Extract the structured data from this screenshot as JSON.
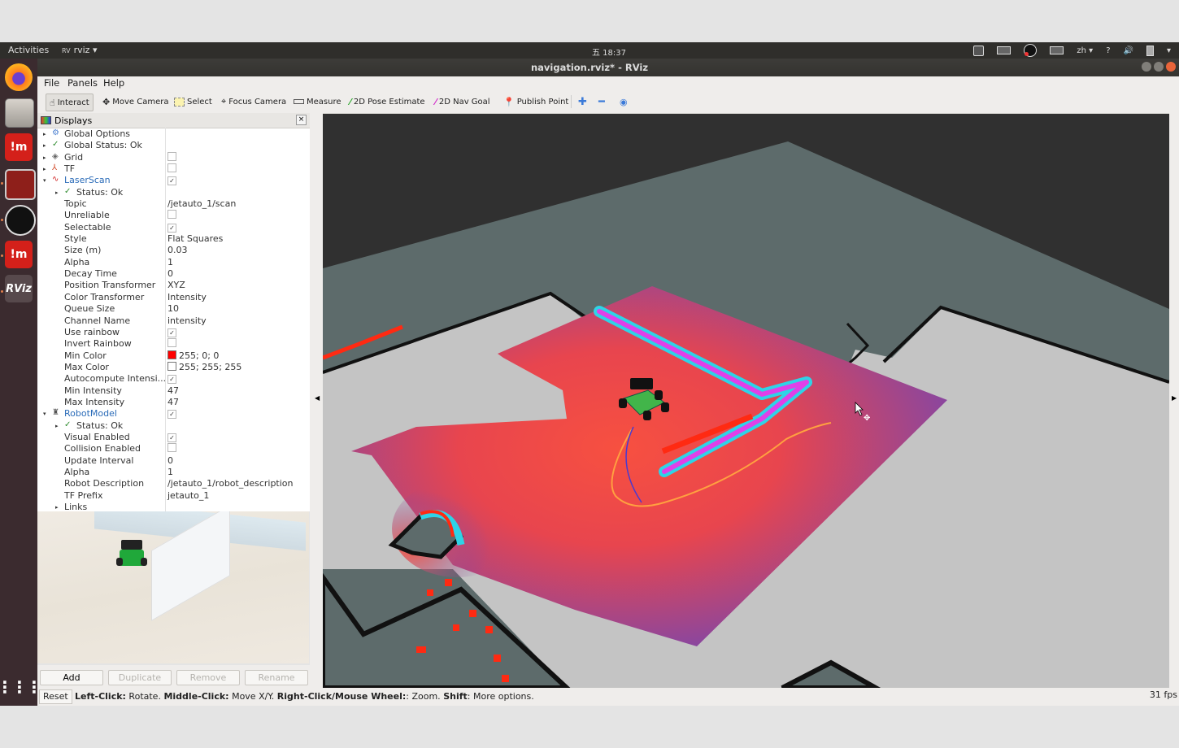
{
  "topbar": {
    "activities": "Activities",
    "app_menu": "rviz ▾",
    "clock": "五 18:37",
    "tray": [
      "im-icon",
      "keyboard-icon",
      "obs-icon",
      "keyboard-icon-2",
      "zh ▾",
      "?",
      "volume-icon",
      "battery-icon",
      "menu-arrow"
    ],
    "lang": "zh ▾",
    "help": "?"
  },
  "window": {
    "title": "navigation.rviz* - RViz"
  },
  "dock": {
    "items": [
      "firefox",
      "files",
      "im-app",
      "video-app",
      "obs",
      "im-app-2",
      "rviz"
    ],
    "rviz_label": "RViz",
    "im_label": "!m",
    "grid_label": "⋮⋮⋮"
  },
  "menu": {
    "file": "File",
    "panels": "Panels",
    "help": "Help"
  },
  "toolbar": {
    "interact": "Interact",
    "move_camera": "Move Camera",
    "select": "Select",
    "focus_camera": "Focus Camera",
    "measure": "Measure",
    "pose_estimate": "2D Pose Estimate",
    "nav_goal": "2D Nav Goal",
    "publish_point": "Publish Point"
  },
  "displays": {
    "title": "Displays",
    "rows": [
      {
        "label": "Global Options",
        "value": ""
      },
      {
        "label": "Global Status: Ok",
        "value": ""
      },
      {
        "label": "Grid",
        "value": ""
      },
      {
        "label": "TF",
        "value": ""
      },
      {
        "label": "LaserScan",
        "value": ""
      },
      {
        "label": "Status: Ok",
        "value": ""
      },
      {
        "label": "Topic",
        "value": "/jetauto_1/scan"
      },
      {
        "label": "Unreliable",
        "value": ""
      },
      {
        "label": "Selectable",
        "value": ""
      },
      {
        "label": "Style",
        "value": "Flat Squares"
      },
      {
        "label": "Size (m)",
        "value": "0.03"
      },
      {
        "label": "Alpha",
        "value": "1"
      },
      {
        "label": "Decay Time",
        "value": "0"
      },
      {
        "label": "Position Transformer",
        "value": "XYZ"
      },
      {
        "label": "Color Transformer",
        "value": "Intensity"
      },
      {
        "label": "Queue Size",
        "value": "10"
      },
      {
        "label": "Channel Name",
        "value": "intensity"
      },
      {
        "label": "Use rainbow",
        "value": ""
      },
      {
        "label": "Invert Rainbow",
        "value": ""
      },
      {
        "label": "Min Color",
        "value": "255; 0; 0"
      },
      {
        "label": "Max Color",
        "value": "255; 255; 255"
      },
      {
        "label": "Autocompute Intensi...",
        "value": ""
      },
      {
        "label": "Min Intensity",
        "value": "47"
      },
      {
        "label": "Max Intensity",
        "value": "47"
      },
      {
        "label": "RobotModel",
        "value": ""
      },
      {
        "label": "Status: Ok",
        "value": ""
      },
      {
        "label": "Visual Enabled",
        "value": ""
      },
      {
        "label": "Collision Enabled",
        "value": ""
      },
      {
        "label": "Update Interval",
        "value": "0"
      },
      {
        "label": "Alpha",
        "value": "1"
      },
      {
        "label": "Robot Description",
        "value": "/jetauto_1/robot_description"
      },
      {
        "label": "TF Prefix",
        "value": "jetauto_1"
      },
      {
        "label": "Links",
        "value": ""
      }
    ],
    "checks": {
      "grid": false,
      "tf": false,
      "laserscan": true,
      "unreliable": false,
      "selectable": true,
      "use_rainbow": true,
      "invert_rainbow": false,
      "autocompute": true,
      "robotmodel": true,
      "visual_enabled": true,
      "collision_enabled": false
    },
    "min_color_hex": "#ff0000",
    "max_color_hex": "#ffffff",
    "check_glyph": "✓",
    "close_glyph": "×"
  },
  "buttons": {
    "add": "Add",
    "duplicate": "Duplicate",
    "remove": "Remove",
    "rename": "Rename"
  },
  "status": {
    "reset": "Reset",
    "hint_parts": [
      {
        "b": "Left-Click:",
        "t": " Rotate. "
      },
      {
        "b": "Middle-Click:",
        "t": " Move X/Y. "
      },
      {
        "b": "Right-Click/Mouse Wheel:",
        "t": ": Zoom. "
      },
      {
        "b": "Shift",
        "t": ": More options."
      }
    ],
    "fps": "31 fps"
  },
  "colors": {
    "laserscan_label": "#2a6bb8",
    "check_green": "#2e8b2e",
    "costmap_hot": "#f04a3e",
    "costmap_cool": "#7f46a8",
    "inflation_cyan": "#2fd3e6",
    "lethal_magenta": "#e040e8",
    "map_free": "#c4c4c4",
    "map_unknown": "#5d6b6b",
    "background": "#303030",
    "path_orange": "#ffa040"
  }
}
